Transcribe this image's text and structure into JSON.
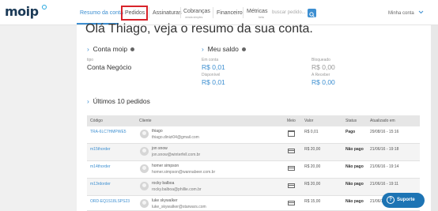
{
  "header": {
    "logo": "moip",
    "nav": [
      {
        "label": "Resumo da conta",
        "sub": ""
      },
      {
        "label": "Pedidos",
        "sub": ""
      },
      {
        "label": "Assinaturas",
        "sub": ""
      },
      {
        "label": "Cobranças",
        "sub": "venda simples"
      },
      {
        "label": "Financeiro",
        "sub": ""
      },
      {
        "label": "Métricas",
        "sub": "beta"
      }
    ],
    "search_placeholder": "buscar pedido...",
    "account": "Minha conta"
  },
  "main": {
    "title": "Olá Thiago, veja o resumo da sua conta.",
    "conta_moip": {
      "heading": "Conta moip",
      "type_label": "tipo",
      "type_value": "Conta Negócio"
    },
    "saldo": {
      "heading": "Meu saldo",
      "em_conta_label": "Em conta",
      "em_conta_value": "R$ 0,01",
      "disponivel_label": "Disponível",
      "disponivel_value": "R$ 0,01",
      "bloqueado_label": "Bloqueado",
      "bloqueado_value": "R$ 0,00",
      "a_receber_label": "A Receber",
      "a_receber_value": "R$ 0,00"
    },
    "orders": {
      "heading": "Últimos 10 pedidos",
      "columns": [
        "Código",
        "Cliente",
        "Meio",
        "Valor",
        "Status",
        "Atualizado em"
      ],
      "rows": [
        {
          "code": "TRA-6LC7HMPWE5",
          "name": "thiago",
          "email": "thiago.dinizi04@gmail.com",
          "method": "bank-slip-icon",
          "value": "R$ 0,01",
          "status": "Pago",
          "updated": "29/08/16 - 15:16"
        },
        {
          "code": "m15thorder",
          "name": "jon snow",
          "email": "jon.snow@winterfell.com.br",
          "method": "credit-card-icon",
          "value": "R$ 20,00",
          "status": "Não pago",
          "updated": "21/06/16 - 19:18"
        },
        {
          "code": "m14thorder",
          "name": "homer simpson",
          "email": "homer.simpson@wannabeer.com.br",
          "method": "credit-card-icon",
          "value": "R$ 20,00",
          "status": "Não pago",
          "updated": "21/06/16 - 19:14"
        },
        {
          "code": "m13rdorder",
          "name": "rocky balboa",
          "email": "rocky.balboa@phillie.com.br",
          "method": "credit-card-icon",
          "value": "R$ 20,00",
          "status": "Não pago",
          "updated": "21/06/16 - 19:11"
        },
        {
          "code": "ORD-EQ1S18LSPS23",
          "name": "luke skywalker",
          "email": "luke_skywalker@starwars.com",
          "method": "credit-card-icon",
          "value": "R$ 15,00",
          "status": "Não pago",
          "updated": "21/06/16 - 16:35"
        }
      ]
    }
  },
  "support_button": "Suporte",
  "colors": {
    "accent": "#3d8fd1",
    "highlight": "#d8232a",
    "support": "#1d74b4"
  }
}
